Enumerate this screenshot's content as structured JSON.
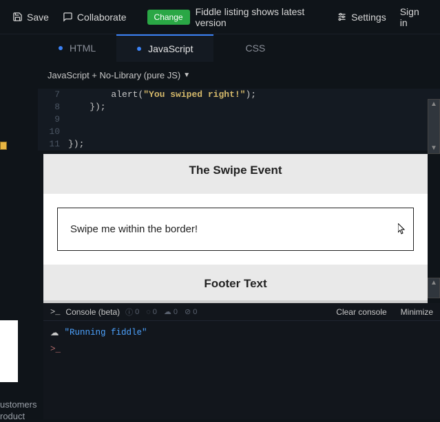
{
  "header": {
    "save": "Save",
    "collaborate": "Collaborate",
    "change_badge": "Change",
    "listing_msg": "Fiddle listing shows latest version",
    "settings": "Settings",
    "signin": "Sign in"
  },
  "tabs": {
    "html": "HTML",
    "js": "JavaScript",
    "css": "CSS"
  },
  "framework": {
    "label": "JavaScript + No-Library (pure JS)"
  },
  "code": {
    "lines": [
      {
        "n": "7",
        "pre": "        ",
        "fn": "alert",
        "open": "(",
        "str": "\"You swiped right!\"",
        "close": ")",
        "tail": ";"
      },
      {
        "n": "8",
        "pre": "    ",
        "plain": "});"
      },
      {
        "n": "9",
        "pre": "",
        "plain": ""
      },
      {
        "n": "10",
        "pre": "",
        "plain": ""
      },
      {
        "n": "11",
        "pre": "",
        "plain": "});"
      }
    ]
  },
  "preview": {
    "title": "The Swipe Event",
    "box_text": "Swipe me within the border!",
    "footer": "Footer Text"
  },
  "console": {
    "title": "Console (beta)",
    "counts": {
      "info": "0",
      "warn": "0",
      "cloud": "0",
      "err": "0"
    },
    "clear": "Clear console",
    "minimize": "Minimize",
    "running": "\"Running fiddle\"",
    "prompt": ">_"
  },
  "leftnav": {
    "line1": "ustomers",
    "line2": "roduct"
  }
}
